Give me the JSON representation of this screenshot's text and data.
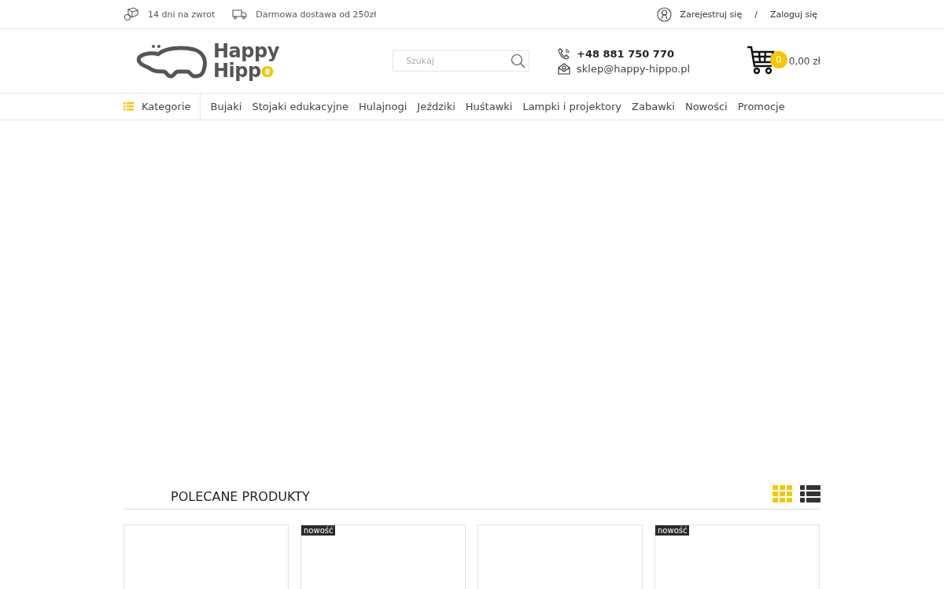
{
  "top_bar": {
    "perks": [
      {
        "kind": "return",
        "label": "14 dni na zwrot"
      },
      {
        "kind": "delivery",
        "label": "Darmowa dostawa od 250zł"
      }
    ],
    "account_links": [
      "Zarejestruj się",
      "Zaloguj się"
    ],
    "separator": "/"
  },
  "header": {
    "logo": {
      "line_1": "Happy",
      "line_2": "Hipp",
      "accent": "o"
    },
    "search": {
      "placeholder": "Szukaj"
    },
    "phone": "+48 881 750 770",
    "email": "sklep@happy-hippo.pl",
    "cart": {
      "count": "0",
      "total": "0,00 zł"
    }
  },
  "nav": {
    "categories_label": "Kategorie",
    "items": [
      "Bujaki",
      "Stojaki edukacyjne",
      "Hulajnogi",
      "Jeździki",
      "Huśtawki",
      "Lampki i projektory",
      "Zabawki",
      "Nowości",
      "Promocje"
    ]
  },
  "featured": {
    "title": "POLECANE PRODUKTY",
    "views": [
      {
        "kind": "grid",
        "selected": true
      },
      {
        "kind": "list",
        "selected": false
      }
    ],
    "products": [
      {
        "is_new": false
      },
      {
        "is_new": true,
        "badge": "nowość"
      },
      {
        "is_new": false
      },
      {
        "is_new": true,
        "badge": "nowość"
      }
    ]
  }
}
